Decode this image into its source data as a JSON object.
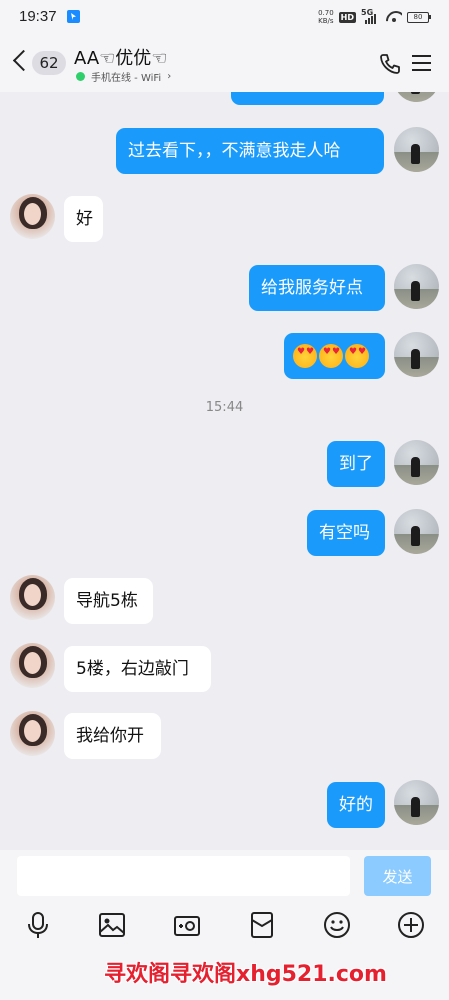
{
  "status_bar": {
    "time": "19:37",
    "net_speed_value": "0.70",
    "net_speed_unit": "KB/s",
    "hd_label": "HD",
    "network_label": "5G",
    "battery_level": "80"
  },
  "header": {
    "unread_count": "62",
    "title": "AA☜优优☜",
    "status_text": "手机在线 - WiFi",
    "status_chevron": "›"
  },
  "messages": [
    {
      "from": "me",
      "text": "过去看下，，不满意我走人哈"
    },
    {
      "from": "other",
      "text": "好"
    },
    {
      "from": "me",
      "text": "给我服务好点"
    },
    {
      "from": "me",
      "type": "emoji",
      "emoji_name": "smiling-face-with-heart-eyes",
      "count": 3
    },
    {
      "type": "timestamp",
      "text": "15:44"
    },
    {
      "from": "me",
      "text": "到了"
    },
    {
      "from": "me",
      "text": "有空吗"
    },
    {
      "from": "other",
      "text": "导航5栋"
    },
    {
      "from": "other",
      "text": "5楼，右边敲门"
    },
    {
      "from": "other",
      "text": "我给你开"
    },
    {
      "from": "me",
      "text": "好的"
    }
  ],
  "composer": {
    "input_value": "",
    "send_label": "发送"
  },
  "toolbar_icons": [
    "microphone-icon",
    "image-icon",
    "camera-icon",
    "red-packet-icon",
    "emoji-icon",
    "plus-icon"
  ],
  "colors": {
    "my_bubble": "#1a9bfc",
    "other_bubble": "#ffffff",
    "background": "#ededf2",
    "online": "#2fd06b"
  },
  "watermark": "寻欢阁寻欢阁xhg521.com"
}
